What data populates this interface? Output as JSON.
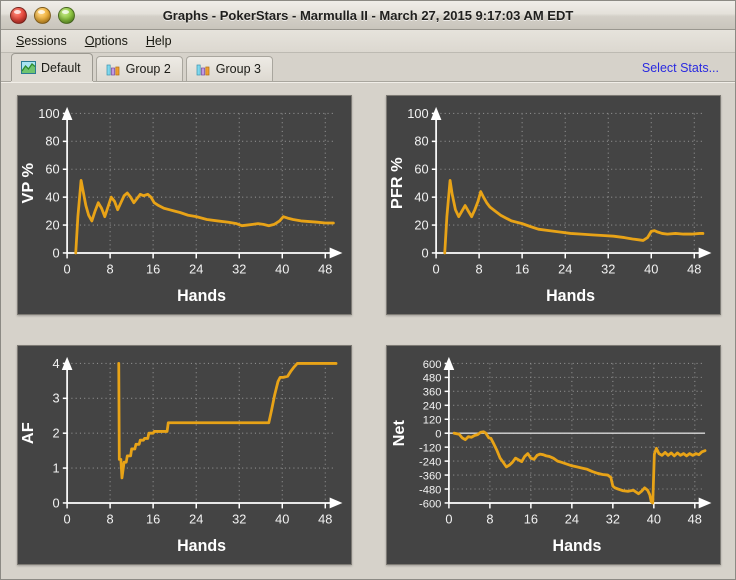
{
  "window": {
    "title": "Graphs - PokerStars - Marmulla II - March 27, 2015 9:17:03 AM EDT",
    "controls": {
      "close": "close-button",
      "minimize": "minimize-button",
      "zoom": "zoom-button"
    }
  },
  "menubar": {
    "items": [
      {
        "label": "Sessions",
        "mnemonic": "S"
      },
      {
        "label": "Options",
        "mnemonic": "O"
      },
      {
        "label": "Help",
        "mnemonic": "H"
      }
    ]
  },
  "tabs": {
    "items": [
      {
        "label": "Default",
        "icon": "area-chart-icon",
        "active": true
      },
      {
        "label": "Group 2",
        "icon": "bar-chart-icon",
        "active": false
      },
      {
        "label": "Group 3",
        "icon": "bar-chart-icon",
        "active": false
      }
    ],
    "select_stats_link": "Select Stats..."
  },
  "colors": {
    "panel_background": "#444444",
    "series": "#e8a317",
    "link": "#2a2ae0",
    "window_background": "#d6d2ca",
    "axis": "#ffffff"
  },
  "chart_data": [
    {
      "type": "line",
      "title": "VP %",
      "xlabel": "Hands",
      "ylabel": "VP %",
      "xlim": [
        0,
        50
      ],
      "ylim": [
        0,
        100
      ],
      "xticks": [
        0,
        8,
        16,
        24,
        32,
        40,
        48
      ],
      "yticks": [
        0,
        20,
        40,
        60,
        80,
        100
      ],
      "grid": true,
      "legend": "none",
      "x": [
        1.6,
        2.0,
        2.6,
        3.0,
        3.5,
        4.0,
        4.6,
        5.2,
        5.8,
        6.4,
        7.0,
        7.6,
        8.2,
        8.8,
        9.4,
        10.0,
        10.6,
        11.2,
        11.8,
        12.4,
        13.0,
        13.6,
        14.2,
        15.0,
        15.6,
        16.2,
        17.0,
        18.0,
        19.0,
        20.0,
        21.0,
        22.5,
        24.0,
        26.0,
        28.0,
        30.0,
        31.5,
        32.5,
        33.5,
        34.5,
        35.5,
        36.5,
        37.5,
        38.5,
        39.5,
        40.2,
        41.0,
        42.0,
        43.5,
        45.0,
        46.5,
        48.0,
        49.5
      ],
      "y": [
        0,
        26,
        52,
        44,
        34,
        27,
        23,
        30,
        36,
        32,
        26,
        33,
        40,
        37,
        31,
        36,
        41,
        43,
        40,
        36,
        39,
        42,
        41,
        42,
        40,
        36,
        34,
        32,
        31,
        30,
        29,
        27,
        26,
        24,
        23,
        22,
        21,
        19.5,
        20,
        20.5,
        21,
        20.5,
        19.5,
        20.5,
        23,
        26,
        25,
        24,
        23,
        22.5,
        22,
        21.5,
        21.5
      ]
    },
    {
      "type": "line",
      "title": "PFR %",
      "xlabel": "Hands",
      "ylabel": "PFR %",
      "xlim": [
        0,
        50
      ],
      "ylim": [
        0,
        100
      ],
      "xticks": [
        0,
        8,
        16,
        24,
        32,
        40,
        48
      ],
      "yticks": [
        0,
        20,
        40,
        60,
        80,
        100
      ],
      "grid": true,
      "legend": "none",
      "x": [
        1.6,
        2.0,
        2.6,
        3.0,
        3.6,
        4.2,
        4.8,
        5.4,
        6.0,
        6.6,
        7.2,
        7.8,
        8.3,
        8.8,
        9.4,
        10.0,
        11.0,
        12.0,
        13.0,
        14.0,
        15.0,
        16.0,
        17.5,
        19.0,
        21.0,
        23.0,
        25.0,
        27.0,
        29.0,
        31.0,
        33.0,
        35.0,
        36.5,
        37.5,
        38.5,
        39.3,
        40.0,
        40.6,
        41.2,
        42.0,
        43.0,
        44.5,
        46.0,
        47.5,
        49.0,
        49.6
      ],
      "y": [
        0,
        26,
        52,
        42,
        31,
        26,
        30,
        34,
        30,
        26,
        31,
        37,
        44,
        40,
        36,
        33,
        30,
        27,
        25,
        23,
        22,
        21,
        19,
        17,
        16,
        15,
        14,
        13.5,
        13,
        12.5,
        12,
        11,
        10,
        9.5,
        9,
        11,
        15.5,
        16,
        15,
        14,
        13.5,
        14,
        13.5,
        13.5,
        14,
        14
      ]
    },
    {
      "type": "line",
      "title": "AF",
      "xlabel": "Hands",
      "ylabel": "AF",
      "xlim": [
        0,
        50
      ],
      "ylim": [
        0,
        4
      ],
      "xticks": [
        0,
        8,
        16,
        24,
        32,
        40,
        48
      ],
      "yticks": [
        0,
        1,
        2,
        3,
        4
      ],
      "grid": true,
      "legend": "none",
      "x": [
        9.6,
        9.7,
        10.0,
        10.2,
        10.6,
        11.0,
        11.2,
        11.8,
        12.0,
        12.6,
        12.8,
        13.4,
        13.6,
        14.2,
        14.4,
        15.0,
        15.2,
        16.0,
        16.2,
        18.6,
        18.8,
        37.5,
        38.0,
        38.6,
        39.2,
        39.6,
        40.2,
        41.0,
        41.6,
        42.2,
        42.8,
        43.4,
        50.0
      ],
      "y": [
        4.0,
        1.25,
        1.25,
        0.72,
        1.17,
        1.17,
        1.35,
        1.35,
        1.55,
        1.55,
        1.68,
        1.68,
        1.8,
        1.8,
        1.85,
        1.85,
        2.0,
        2.0,
        2.05,
        2.05,
        2.3,
        2.3,
        2.65,
        3.1,
        3.48,
        3.6,
        3.6,
        3.63,
        3.78,
        3.9,
        4.0,
        4.0,
        4.0
      ]
    },
    {
      "type": "line",
      "title": "Net",
      "xlabel": "Hands",
      "ylabel": "Net",
      "xlim": [
        0,
        50
      ],
      "ylim": [
        -600,
        600
      ],
      "xticks": [
        0,
        8,
        16,
        24,
        32,
        40,
        48
      ],
      "yticks": [
        600,
        480,
        360,
        240,
        120,
        0,
        -120,
        -240,
        -360,
        -480,
        -600
      ],
      "grid": true,
      "zero_line": true,
      "legend": "none",
      "x": [
        1.0,
        2.0,
        2.6,
        3.2,
        3.8,
        4.4,
        5.0,
        5.6,
        6.2,
        6.8,
        7.2,
        7.8,
        8.2,
        8.8,
        9.4,
        10.0,
        10.6,
        11.2,
        11.8,
        12.4,
        13.0,
        13.6,
        14.2,
        14.8,
        15.4,
        16.0,
        16.6,
        17.2,
        17.8,
        18.4,
        19.0,
        19.6,
        20.4,
        21.2,
        22.0,
        23.0,
        24.0,
        25.0,
        26.0,
        27.0,
        28.0,
        29.0,
        30.0,
        31.0,
        31.6,
        32.0,
        32.4,
        33.0,
        34.0,
        35.0,
        36.0,
        37.0,
        37.6,
        38.2,
        38.8,
        39.2,
        39.5,
        39.8,
        40.1,
        40.5,
        41.0,
        41.6,
        42.2,
        42.8,
        43.4,
        44.0,
        44.6,
        45.2,
        45.8,
        46.4,
        47.0,
        47.6,
        48.2,
        48.8,
        49.4,
        50.0
      ],
      "y": [
        0,
        -8,
        -40,
        -55,
        -30,
        -35,
        -20,
        -12,
        8,
        12,
        0,
        -40,
        -45,
        -95,
        -150,
        -215,
        -250,
        -290,
        -275,
        -250,
        -215,
        -230,
        -245,
        -200,
        -175,
        -215,
        -225,
        -190,
        -180,
        -185,
        -195,
        -200,
        -215,
        -240,
        -250,
        -265,
        -280,
        -290,
        -300,
        -310,
        -330,
        -345,
        -355,
        -360,
        -380,
        -455,
        -470,
        -480,
        -495,
        -500,
        -490,
        -520,
        -500,
        -470,
        -490,
        -530,
        -590,
        -600,
        -180,
        -130,
        -175,
        -190,
        -165,
        -190,
        -170,
        -195,
        -170,
        -190,
        -175,
        -195,
        -175,
        -190,
        -175,
        -185,
        -160,
        -150
      ]
    }
  ]
}
